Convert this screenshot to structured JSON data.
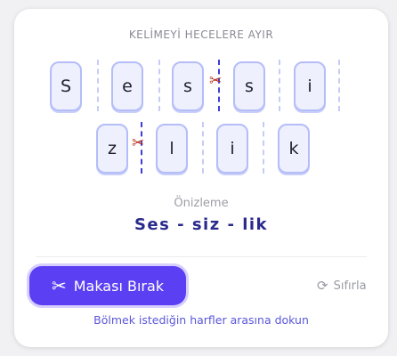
{
  "title": "KELİMEYİ HECELERE AYIR",
  "rows": [
    {
      "letters": [
        "S",
        "e",
        "s",
        "s",
        "i"
      ],
      "gaps": [
        false,
        false,
        true,
        false,
        false
      ]
    },
    {
      "letters": [
        "z",
        "l",
        "i",
        "k"
      ],
      "gaps": [
        true,
        false,
        false,
        false
      ]
    }
  ],
  "preview": {
    "label": "Önizleme",
    "text": "Ses - siz - lik"
  },
  "actions": {
    "cut_label": "Makası Bırak",
    "cut_icon": "scissors-icon",
    "reset_label": "Sıfırla",
    "reset_icon": "refresh-icon"
  },
  "hint": "Bölmek istediğin harfler arasına dokun",
  "colors": {
    "accent": "#5b3ff2",
    "tile_bg": "#eef0fe",
    "tile_border": "#b4bdf8",
    "cut_line": "#3d3dd8",
    "scissor": "#b5311e"
  }
}
